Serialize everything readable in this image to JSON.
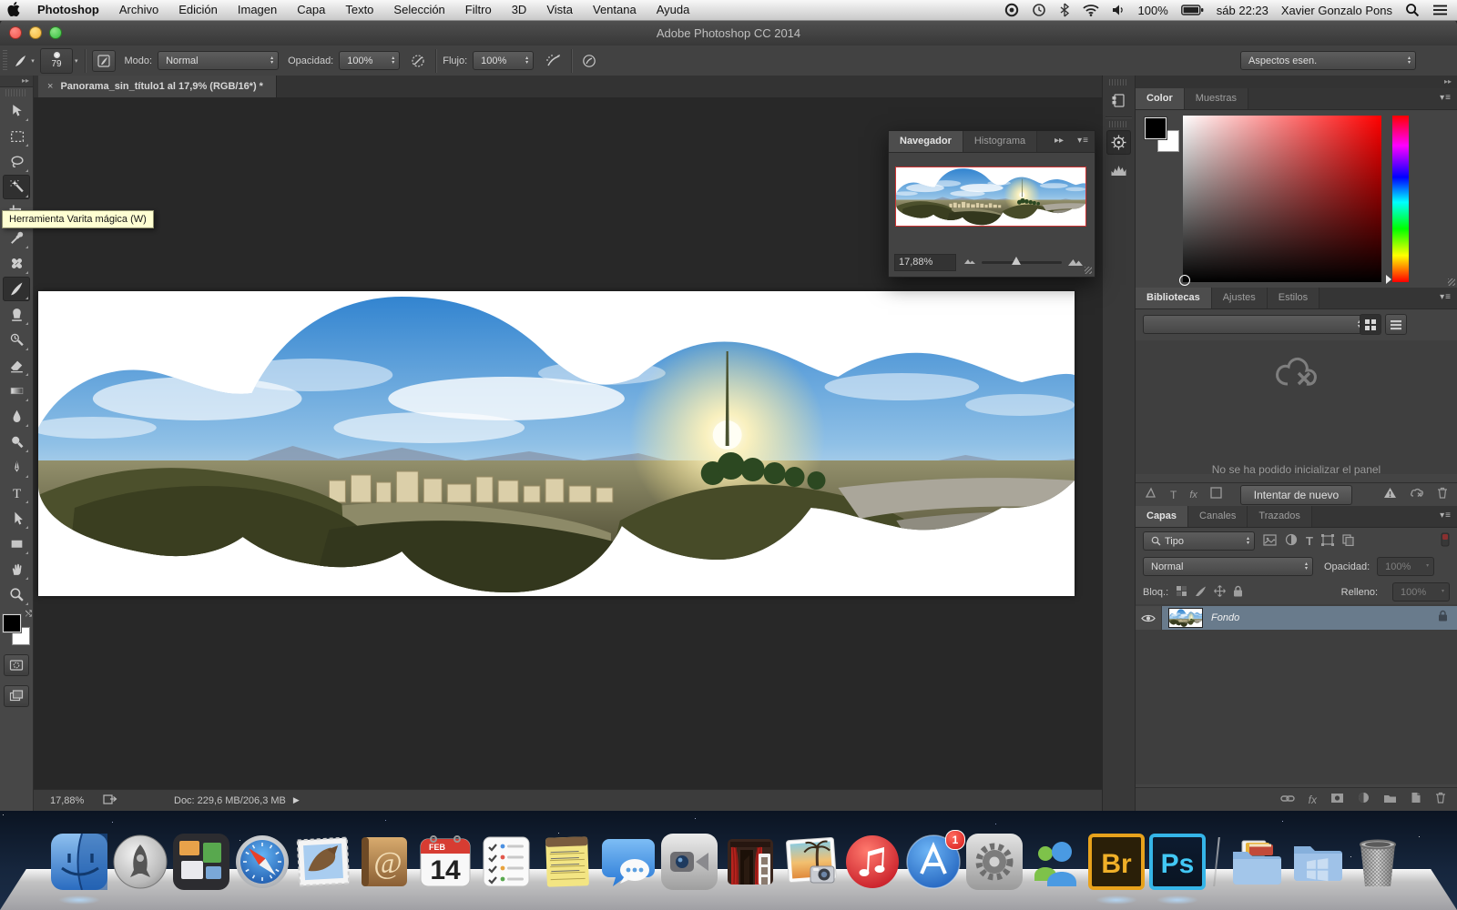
{
  "menubar": {
    "apple": "",
    "items": [
      "Photoshop",
      "Archivo",
      "Edición",
      "Imagen",
      "Capa",
      "Texto",
      "Selección",
      "Filtro",
      "3D",
      "Vista",
      "Ventana",
      "Ayuda"
    ],
    "tray": {
      "battery": "100%",
      "clock": "sáb 22:23",
      "user": "Xavier Gonzalo Pons"
    }
  },
  "window": {
    "title": "Adobe Photoshop CC 2014"
  },
  "options": {
    "brush_size": "79",
    "modo_label": "Modo:",
    "modo": "Normal",
    "opacidad_label": "Opacidad:",
    "opacidad": "100%",
    "flujo_label": "Flujo:",
    "flujo": "100%",
    "workspace": "Aspectos esen."
  },
  "document": {
    "tab_title": "Panorama_sin_título1 al 17,9% (RGB/16*) *",
    "close_glyph": "×",
    "zoom": "17,88%",
    "doc_size": "Doc: 229,6 MB/206,3 MB"
  },
  "tooltip": {
    "text": "Herramienta Varita mágica (W)"
  },
  "toolbar": {
    "tools": [
      "move",
      "marquee",
      "lasso",
      "magic-wand",
      "crop",
      "eyedropper",
      "healing",
      "brush",
      "clone-stamp",
      "history-brush",
      "eraser",
      "gradient",
      "blur",
      "dodge",
      "pen",
      "type",
      "path-select",
      "shape",
      "hand",
      "zoom"
    ],
    "active_tools": [
      "magic-wand",
      "brush"
    ]
  },
  "navigator": {
    "tab_navegador": "Navegador",
    "tab_histograma": "Histograma",
    "zoom": "17,88%"
  },
  "color": {
    "tab_color": "Color",
    "tab_muestras": "Muestras"
  },
  "libraries": {
    "tab_bibliotecas": "Bibliotecas",
    "tab_ajustes": "Ajustes",
    "tab_estilos": "Estilos",
    "message": "No se ha podido inicializar el panel",
    "retry_button": "Intentar de nuevo"
  },
  "layers": {
    "tab_capas": "Capas",
    "tab_canales": "Canales",
    "tab_trazados": "Trazados",
    "filter_kind": "Tipo",
    "blend_mode": "Normal",
    "opacity_label": "Opacidad:",
    "opacity": "100%",
    "lock_label": "Bloq.:",
    "fill_label": "Relleno:",
    "fill": "100%",
    "layer_name": "Fondo",
    "fx_label": "fx"
  },
  "dock": {
    "apps": [
      "finder",
      "launchpad",
      "dashboard",
      "safari",
      "mail",
      "contacts",
      "calendar",
      "reminders",
      "notes",
      "messages",
      "facetime",
      "photo-booth",
      "iphoto",
      "itunes",
      "app-store",
      "system-preferences",
      "messenger",
      "bridge",
      "photoshop",
      "divider",
      "documents-folder",
      "windows-folder",
      "trash"
    ],
    "calendar_month": "FEB",
    "calendar_day": "14",
    "bridge_label": "Br",
    "photoshop_label": "Ps",
    "app_store_badge": "1"
  },
  "colors": {
    "accent_blue": "#697b8c",
    "tooltip_bg": "#ffffd2",
    "hue_red": "#ff0000"
  }
}
